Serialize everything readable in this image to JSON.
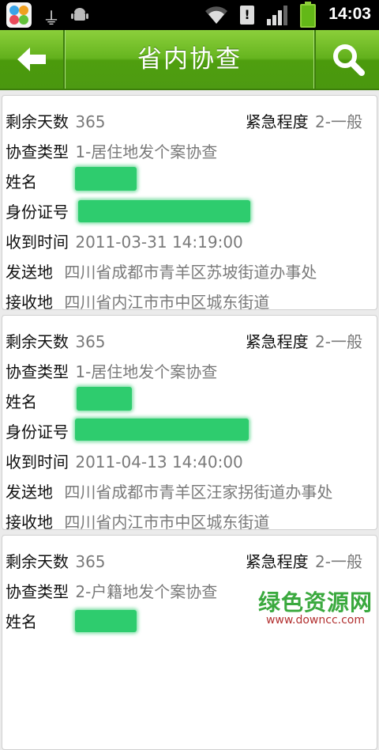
{
  "status_bar": {
    "time": "14:03",
    "icons": [
      "app-market-icon",
      "usb-icon",
      "android-debug-icon",
      "wifi-icon",
      "alert-icon",
      "signal-icon",
      "battery-icon"
    ]
  },
  "header": {
    "title": "省内协查",
    "back_icon": "arrow-left-icon",
    "search_icon": "search-icon"
  },
  "labels": {
    "remaining_days": "剩余天数",
    "urgency": "紧急程度",
    "type": "协查类型",
    "name": "姓名",
    "id_number": "身份证号",
    "received_time": "收到时间",
    "sender": "发送地",
    "receiver": "接收地"
  },
  "records": [
    {
      "remaining_days": "365",
      "urgency": "2-一般",
      "type": "1-居住地发个案协查",
      "received_time": "2011-03-31 14:19:00",
      "sender": "四川省成都市青羊区苏坡街道办事处",
      "receiver": "四川省内江市市中区城东街道"
    },
    {
      "remaining_days": "365",
      "urgency": "2-一般",
      "type": "1-居住地发个案协查",
      "received_time": "2011-04-13 14:40:00",
      "sender": "四川省成都市青羊区汪家拐街道办事处",
      "receiver": "四川省内江市市中区城东街道"
    },
    {
      "remaining_days": "365",
      "urgency": "2-一般",
      "type": "2-户籍地发个案协查"
    }
  ],
  "watermark": {
    "main": "绿色资源网",
    "sub": "www.downcc.com"
  },
  "colors": {
    "header_green": "#5aad18",
    "redaction_green": "#2ecc6e",
    "value_gray": "#7a7a7a"
  }
}
